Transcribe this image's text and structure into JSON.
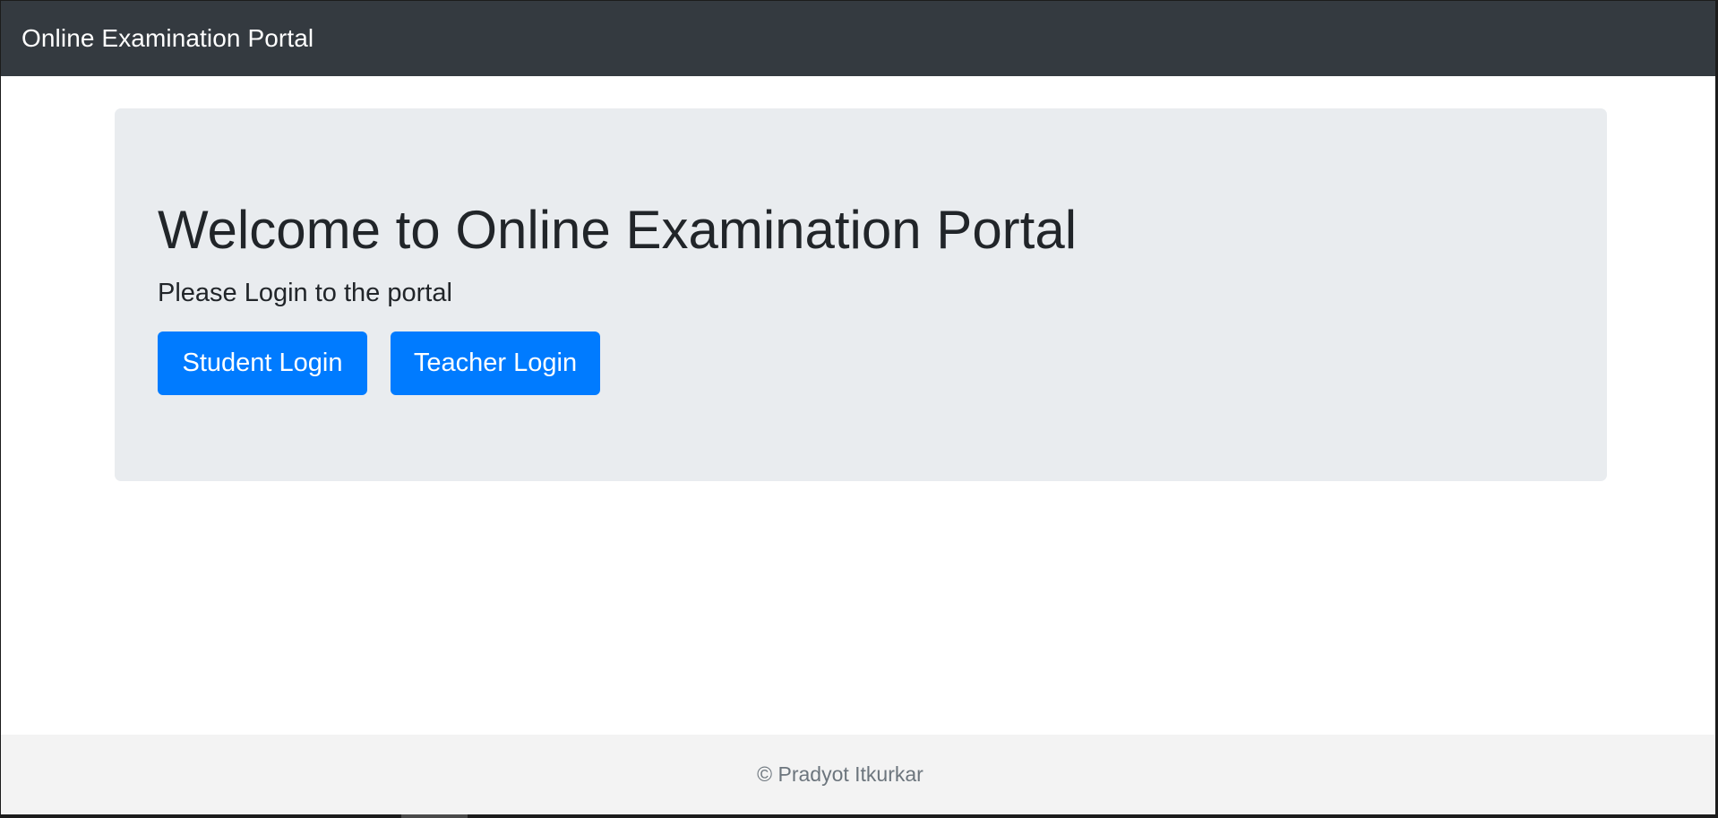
{
  "navbar": {
    "brand": "Online Examination Portal"
  },
  "jumbotron": {
    "title": "Welcome to Online Examination Portal",
    "subtitle": "Please Login to the portal",
    "buttons": [
      {
        "label": "Student Login"
      },
      {
        "label": "Teacher Login"
      }
    ]
  },
  "footer": {
    "text": "© Pradyot Itkurkar"
  },
  "colors": {
    "navbar_bg": "#343a40",
    "jumbotron_bg": "#e9ecef",
    "primary_button": "#007bff",
    "footer_bg": "#f3f3f3"
  }
}
